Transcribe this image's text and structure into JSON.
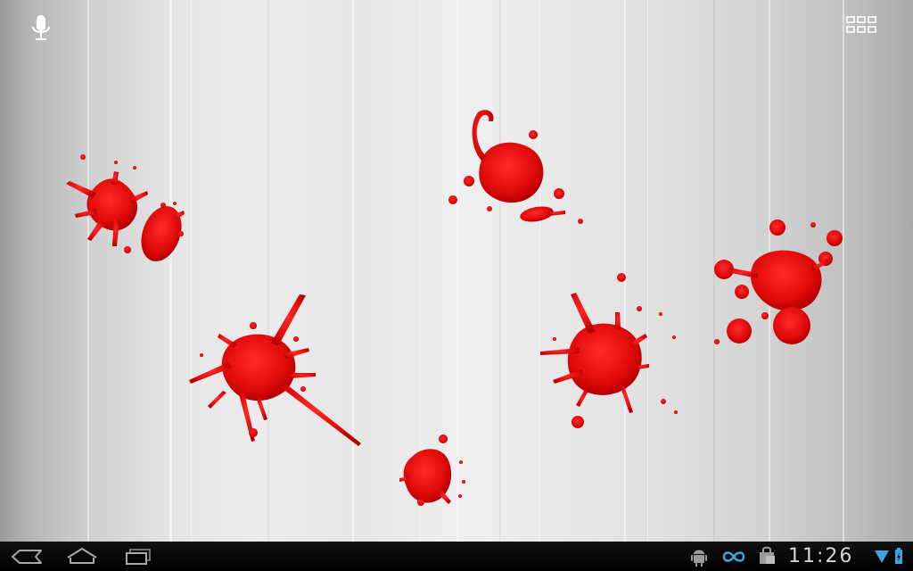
{
  "status_bar": {
    "time": "11:26"
  },
  "colors": {
    "blood": "#e00a0a",
    "blood_dark": "#b30000",
    "status_icon_blue": "#3fa3e0",
    "status_icon_gray": "#9a9a9a",
    "navbar_bg": "#000000"
  },
  "icons": {
    "voice_search": "mic-icon",
    "all_apps": "grid-icon",
    "back": "back-icon",
    "home": "home-icon",
    "recent_apps": "recent-apps-icon",
    "usb_debugging": "android-icon",
    "link": "infinity-icon",
    "store": "shopping-bag-icon",
    "wifi": "wifi-icon",
    "battery": "battery-icon"
  }
}
